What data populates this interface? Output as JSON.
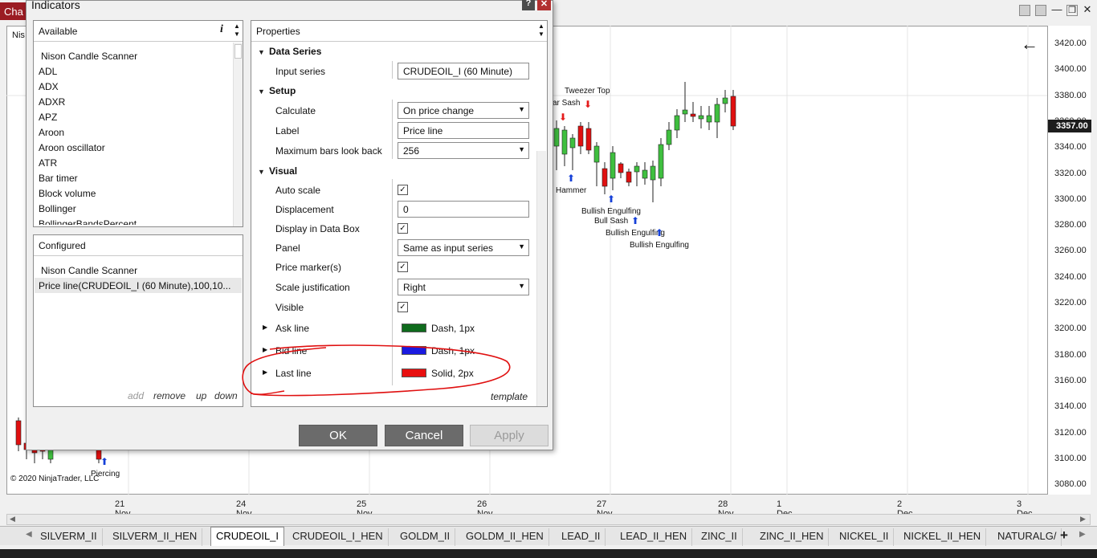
{
  "window": {
    "title_truncated": "Cha",
    "chart_title_truncated": "Nis"
  },
  "dialog": {
    "title": "Indicators",
    "help_label": "?",
    "close_label": "✕",
    "available": {
      "header": "Available",
      "info_label": "i",
      "items": [
        "Nison Candle Scanner",
        "ADL",
        "ADX",
        "ADXR",
        "APZ",
        "Aroon",
        "Aroon oscillator",
        "ATR",
        "Bar timer",
        "Block volume",
        "Bollinger",
        "BollingerBandsPercent"
      ]
    },
    "configured": {
      "header": "Configured",
      "items": [
        "Nison Candle Scanner",
        "Price line(CRUDEOIL_I (60 Minute),100,10..."
      ],
      "actions": {
        "add": "add",
        "remove": "remove",
        "up": "up",
        "down": "down"
      }
    },
    "properties": {
      "header": "Properties",
      "sections": {
        "data_series": "Data Series",
        "setup": "Setup",
        "visual": "Visual"
      },
      "input_series": {
        "label": "Input series",
        "value": "CRUDEOIL_I (60 Minute)"
      },
      "calculate": {
        "label": "Calculate",
        "value": "On price change"
      },
      "label_field": {
        "label": "Label",
        "value": "Price line"
      },
      "max_bars": {
        "label": "Maximum bars look back",
        "value": "256"
      },
      "auto_scale": {
        "label": "Auto scale",
        "checked": true
      },
      "displacement": {
        "label": "Displacement",
        "value": "0"
      },
      "display_in_data_box": {
        "label": "Display in Data Box",
        "checked": true
      },
      "panel": {
        "label": "Panel",
        "value": "Same as input series"
      },
      "price_markers": {
        "label": "Price marker(s)",
        "checked": true
      },
      "scale_justification": {
        "label": "Scale justification",
        "value": "Right"
      },
      "visible": {
        "label": "Visible",
        "checked": true
      },
      "ask_line": {
        "label": "Ask line",
        "value": "Dash, 1px",
        "color": "#0f6b1d"
      },
      "bid_line": {
        "label": "Bid line",
        "value": "Dash, 1px",
        "color": "#1a1ae0"
      },
      "last_line": {
        "label": "Last line",
        "value": "Solid, 2px",
        "color": "#e81010"
      },
      "template_label": "template"
    },
    "buttons": {
      "ok": "OK",
      "cancel": "Cancel",
      "apply": "Apply"
    },
    "checkmark": "✓"
  },
  "chart": {
    "price_ticks": [
      "3420.00",
      "3400.00",
      "3380.00",
      "3360.00",
      "3340.00",
      "3320.00",
      "3300.00",
      "3280.00",
      "3260.00",
      "3240.00",
      "3220.00",
      "3200.00",
      "3180.00",
      "3160.00",
      "3140.00",
      "3120.00",
      "3100.00",
      "3080.00"
    ],
    "last_price": "3357.00",
    "date_ticks": [
      "21 Nov",
      "24 Nov",
      "25 Nov",
      "26 Nov",
      "27 Nov",
      "28 Nov",
      "1 Dec",
      "2 Dec",
      "3 Dec"
    ],
    "copyright": "© 2020 NinjaTrader, LLC",
    "pattern_labels": {
      "tweezer_top": "Tweezer Top",
      "bear_sash": "ar Sash",
      "hammer": "Hammer",
      "bullish_engulfing_1": "Bullish Engulfing",
      "bull_sash": "Bull Sash",
      "bullish_engulfing_2": "Bullish Engulfing",
      "bullish_engulfing_3": "Bullish Engulfing",
      "piercing": "Piercing"
    },
    "back_arrow_icon": "arrow-left-icon"
  },
  "tabs": [
    "SILVERM_II",
    "SILVERM_II_HEN",
    "CRUDEOIL_I",
    "CRUDEOIL_I_HEN",
    "GOLDM_II",
    "GOLDM_II_HEN",
    "LEAD_II",
    "LEAD_II_HEN",
    "ZINC_II",
    "ZINC_II_HEN",
    "NICKEL_II",
    "NICKEL_II_HEN",
    "NATURALG/"
  ],
  "active_tab": "CRUDEOIL_I",
  "add_tab_label": "+",
  "colors": {
    "annotation": "#e01010",
    "bull": "#3fbf3f",
    "bear": "#e01010",
    "accent": "#9b1c23"
  }
}
